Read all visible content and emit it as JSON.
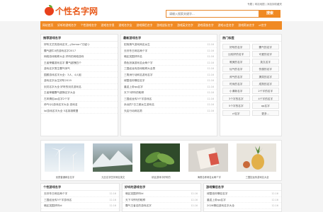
{
  "site": {
    "logo_text": "个性名字网",
    "top_links": "专题 | 网站地图 | 添加到收藏夹",
    "search_placeholder": "请输入搜索关键字...",
    "search_button": "搜索"
  },
  "nav": [
    "网站首页",
    "好听的游戏名字",
    "个性游戏名字",
    "游戏名字男",
    "游戏名字女",
    "游戏情侣名字",
    "游戏战队名字",
    "游戏英文名字",
    "游戏家族名字",
    "游戏公会名字",
    "游戏帮派名字",
    "cf名字"
  ],
  "recommended": {
    "title": "推荐游戏名字",
    "items": [
      "好听文艺的游戏名字_-¿Demon°冗墟つ",
      "霸气超牛X的游戏名字2017",
      "网络游戏昵称大全 好听的网络游戏",
      "王者荣耀游戏名字 霸气超拽四个",
      "游戏名字男生霸气帅气",
      "国服游戏名字大全：3人、4人组",
      "游戏名字女生好听2019",
      "剑灵名字大全 好听的剑灵游戏名",
      "王者荣耀霸气超拽名字大全",
      "古风情侣qq名字2个字",
      "帅气QQ游戏名字大全 游戏名",
      "lol游戏名字大全 5名英雄联盟"
    ]
  },
  "latest": {
    "title": "最新游戏名字",
    "items": [
      {
        "t": "犯贱拽气游戏网名女生",
        "d": "12-16"
      },
      {
        "t": "无尽冬日网名两个字",
        "d": "12-16"
      },
      {
        "t": "暗区突围好听名",
        "d": "12-16"
      },
      {
        "t": "角色扮演游戏名女两个字",
        "d": "12-16"
      },
      {
        "t": "三国如龙传游戏昵称大全男",
        "d": "12-16"
      },
      {
        "t": "三角洲行动网名游戏名字",
        "d": "12-16"
      },
      {
        "t": "绿茵信仰情侣名字",
        "d": "12-16"
      },
      {
        "t": "重返上帝qq名字",
        "d": "12-16"
      },
      {
        "t": "天下3好听的昵称",
        "d": "12-16"
      },
      {
        "t": "三国如龙传3个字游戏名",
        "d": "12-16"
      },
      {
        "t": "永远的7日之都女生游戏名",
        "d": "12-16"
      },
      {
        "t": "天启行动网名男",
        "d": "12-16"
      }
    ]
  },
  "hot": {
    "title": "热门标签",
    "tags": [
      "好听的名字",
      "霸气的名字",
      "比较好的名字",
      "可爱的名字",
      "唯美的名字",
      "英文名字",
      "仙气的名字",
      "伤感的名字",
      "帅气的名字",
      "搞笑的名字",
      "时尚的名字",
      "成熟的名字",
      "小清新名字",
      "2个字的名字",
      "3个字的名字",
      "4个字的名字",
      "5个字的名字",
      "qq名字",
      "cf名字",
      "更多..."
    ]
  },
  "gallery": [
    {
      "caption": "优质普通网名名字",
      "icon": "wind-turbine-image"
    },
    {
      "caption": "元旦名字四字网名英文",
      "icon": "mountain-snow-image"
    },
    {
      "caption": "精区游戏中好听的",
      "icon": "plant-image"
    },
    {
      "caption": "海角名称网名女两个字",
      "icon": "card-image"
    },
    {
      "caption": "三国如龙传游戏名大全",
      "icon": "pineapple-image"
    }
  ],
  "bottom": {
    "col1": {
      "title": "个性游戏名字",
      "items": [
        {
          "t": "无尽冬日网名两个字",
          "d": "12-16"
        },
        {
          "t": "三国如龙传3个字游戏名",
          "d": "12-16"
        },
        {
          "t": "暗区突围好听ld",
          "d": "12-16"
        }
      ]
    },
    "col2": {
      "title": "好听的游戏名字",
      "items": [
        {
          "t": "暗区突围好听ld",
          "d": "12-16"
        },
        {
          "t": "天下3好听的昵称",
          "d": "12-16"
        },
        {
          "t": "霸气王者名的游戏名字",
          "d": "12-16"
        }
      ]
    },
    "col3": {
      "title": "游戏情侣名字",
      "items": [
        {
          "t": "绿茵信仰情侣名字",
          "d": "12-16"
        },
        {
          "t": "重返上帝qq名字",
          "d": "12-16"
        },
        {
          "t": "2026情侣游戏名字大全",
          "d": "12-16"
        }
      ]
    }
  },
  "colors": {
    "accent": "#f08a24",
    "logo": "#e85a1b"
  }
}
